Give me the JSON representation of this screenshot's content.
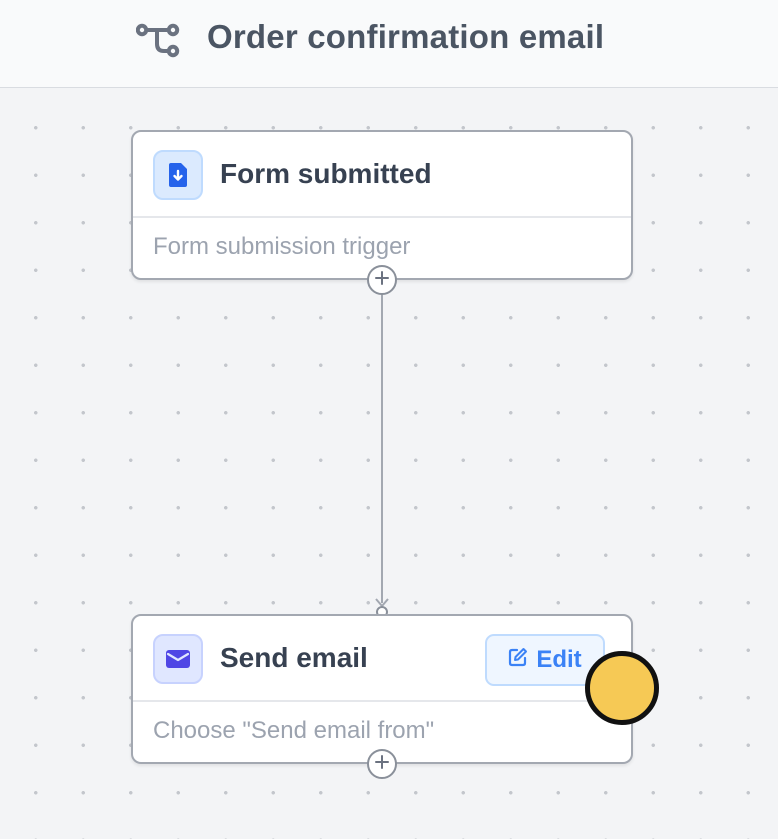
{
  "header": {
    "title": "Order confirmation email",
    "icon": "workflow-icon"
  },
  "nodes": [
    {
      "title": "Form submitted",
      "subtitle": "Form submission trigger",
      "icon": "form-document-icon",
      "icon_color": "#2563eb"
    },
    {
      "title": "Send email",
      "subtitle": "Choose \"Send email from\"",
      "icon": "mail-icon",
      "icon_color": "#4f46e5",
      "edit_label": "Edit"
    }
  ],
  "colors": {
    "accent": "#3b82f6",
    "cursor": "#f6c955"
  }
}
